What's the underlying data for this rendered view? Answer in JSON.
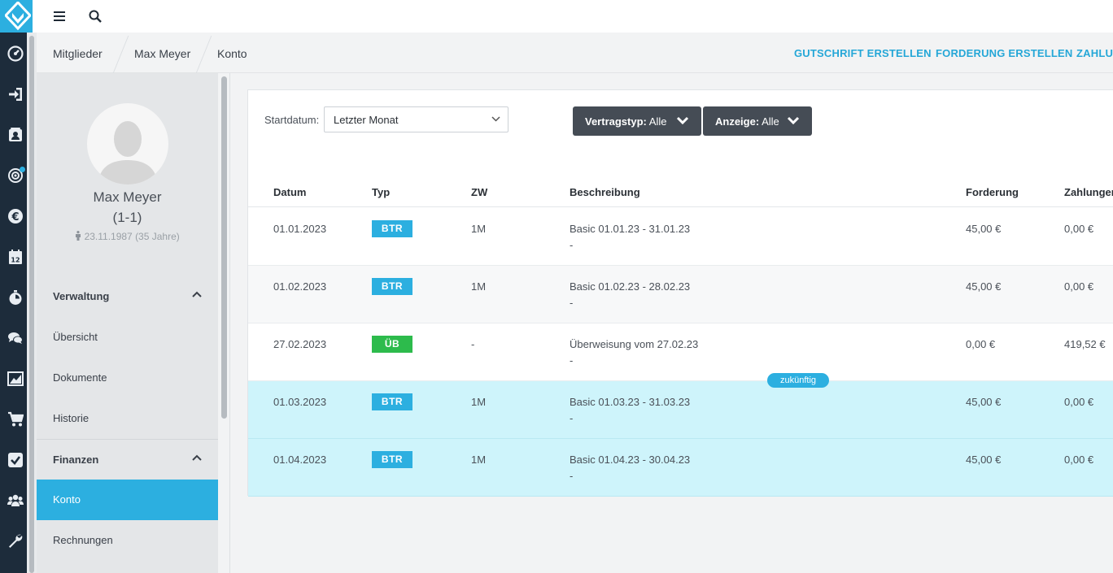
{
  "colors": {
    "accent": "#2cafe0",
    "rail": "#1d2c3b",
    "badge_btr": "#2cafe0",
    "badge_ub": "#2dbb4c",
    "future_row": "#cef4fb"
  },
  "rail_icons": [
    "dashboard-icon",
    "login-icon",
    "members-card-icon",
    "target-icon",
    "euro-icon",
    "calendar-icon",
    "stopwatch-icon",
    "chat-icon",
    "chart-icon",
    "cart-icon",
    "checkbox-icon",
    "group-icon",
    "wrench-icon"
  ],
  "calendar_icon_day": "12",
  "breadcrumb": [
    "Mitglieder",
    "Max Meyer",
    "Konto"
  ],
  "actions": {
    "gutschrift": "GUTSCHRIFT ERSTELLEN",
    "forderung": "FORDERUNG ERSTELLEN",
    "zahlung": "ZAHLUN"
  },
  "profile": {
    "name": "Max Meyer",
    "number": "(1-1)",
    "dob": "23.11.1987 (35 Jahre)"
  },
  "nav": {
    "verwaltung": "Verwaltung",
    "uebersicht": "Übersicht",
    "dokumente": "Dokumente",
    "historie": "Historie",
    "finanzen": "Finanzen",
    "konto": "Konto",
    "rechnungen": "Rechnungen"
  },
  "filters": {
    "start_label": "Startdatum:",
    "start_value": "Letzter Monat",
    "vertragstyp_label": "Vertragstyp:",
    "vertragstyp_value": "Alle",
    "anzeige_label": "Anzeige:",
    "anzeige_value": "Alle"
  },
  "table": {
    "headers": [
      "Datum",
      "Typ",
      "ZW",
      "Beschreibung",
      "Forderung",
      "Zahlunger"
    ],
    "future_label": "zukünftig",
    "rows": [
      {
        "date": "01.01.2023",
        "type": "BTR",
        "zw": "1M",
        "desc": "Basic 01.01.23 - 31.01.23",
        "sub": "-",
        "forderung": "45,00 €",
        "zahlung": "0,00 €"
      },
      {
        "date": "01.02.2023",
        "type": "BTR",
        "zw": "1M",
        "desc": "Basic 01.02.23 - 28.02.23",
        "sub": "-",
        "forderung": "45,00 €",
        "zahlung": "0,00 €"
      },
      {
        "date": "27.02.2023",
        "type": "ÜB",
        "zw": "-",
        "desc": "Überweisung vom 27.02.23",
        "sub": "-",
        "forderung": "0,00 €",
        "zahlung": "419,52 €"
      },
      {
        "date": "01.03.2023",
        "type": "BTR",
        "zw": "1M",
        "desc": "Basic 01.03.23 - 31.03.23",
        "sub": "-",
        "forderung": "45,00 €",
        "zahlung": "0,00 €"
      },
      {
        "date": "01.04.2023",
        "type": "BTR",
        "zw": "1M",
        "desc": "Basic 01.04.23 - 30.04.23",
        "sub": "-",
        "forderung": "45,00 €",
        "zahlung": "0,00 €"
      }
    ]
  }
}
